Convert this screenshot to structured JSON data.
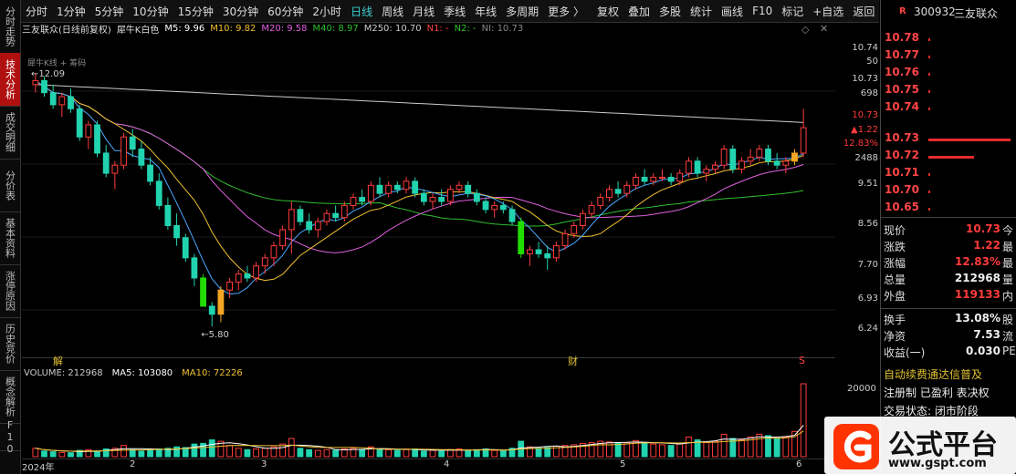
{
  "sidebar": {
    "tabs": [
      {
        "label": "分时走势",
        "active": false
      },
      {
        "label": "技术分析",
        "active": true
      },
      {
        "label": "成交明细",
        "active": false
      },
      {
        "label": "分价表",
        "active": false
      },
      {
        "label": "基本资料",
        "active": false
      },
      {
        "label": "涨停原因",
        "active": false
      },
      {
        "label": "历史竞价",
        "active": false
      },
      {
        "label": "概念解析",
        "active": false
      },
      {
        "label": "F10",
        "active": false
      }
    ]
  },
  "toolbar": {
    "periods": [
      "分时",
      "1分钟",
      "5分钟",
      "10分钟",
      "15分钟",
      "30分钟",
      "60分钟",
      "2小时",
      "日线",
      "周线",
      "月线",
      "季线",
      "年线",
      "多周期",
      "更多 〉"
    ],
    "active_period": "日线",
    "actions": [
      "复权",
      "叠加",
      "多股",
      "统计",
      "画线",
      "F10",
      "标记",
      "+自选",
      "返回"
    ]
  },
  "infoline": {
    "title": "三友联众(日线前复权)",
    "subtitle": "犀牛K白色",
    "ma5": "M5: 9.96",
    "ma10": "M10: 9.82",
    "ma20": "M20: 9.58",
    "ma40": "M40: 8.97",
    "ma250": "M250: 10.70",
    "n1": "N1: -",
    "n2": "N2: -",
    "ni": "NI: 10.73"
  },
  "chart_overlay": {
    "high_label": "12.09",
    "low_label": "←5.80",
    "small_label": "犀牛K线 + 筹码"
  },
  "markers": {
    "jie": "解",
    "cai": "财",
    "s": "S"
  },
  "price_axis": [
    "10.74",
    "50",
    "10.73",
    "698",
    "10.73",
    "▲1.22",
    "12.83%",
    "2488",
    "9.51",
    "8.56",
    "7.70",
    "6.93",
    "6.24"
  ],
  "volume": {
    "label": "VOLUME: 212968",
    "ma5": "MA5: 103080",
    "ma10": "MA10: 72226",
    "axis_top": "20000"
  },
  "time_axis": [
    "2024年",
    "2",
    "3",
    "4",
    "5",
    "6"
  ],
  "right_panel": {
    "code": "300932",
    "name": "三友联众",
    "badge": "R",
    "ladder": [
      {
        "price": "10.78",
        "bar": 2
      },
      {
        "price": "10.77",
        "bar": 2
      },
      {
        "price": "10.76",
        "bar": 2
      },
      {
        "price": "10.75",
        "bar": 2
      },
      {
        "price": "10.74",
        "bar": 2
      },
      {
        "price": "10.73",
        "bar": 100
      },
      {
        "price": "10.72",
        "bar": 55
      },
      {
        "price": "10.71",
        "bar": 2
      },
      {
        "price": "10.70",
        "bar": 2
      },
      {
        "price": "10.65",
        "bar": 2
      }
    ],
    "quote": [
      {
        "k": "现价",
        "v": "10.73",
        "k2": "今",
        "c": "red"
      },
      {
        "k": "涨跌",
        "v": "1.22",
        "k2": "最",
        "c": "red"
      },
      {
        "k": "涨幅",
        "v": "12.83%",
        "k2": "最",
        "c": "red"
      },
      {
        "k": "总量",
        "v": "212968",
        "k2": "量",
        "c": "white"
      },
      {
        "k": "外盘",
        "v": "119133",
        "k2": "内",
        "c": "red"
      }
    ],
    "quote2": [
      {
        "k": "换手",
        "v": "13.08%",
        "k2": "股",
        "c": "white"
      },
      {
        "k": "净资",
        "v": "7.53",
        "k2": "流",
        "c": "white"
      },
      {
        "k": "收益(一)",
        "v": "0.030",
        "k2": "PE",
        "c": "white"
      }
    ],
    "news": [
      {
        "text": "自动续费通达信普及",
        "c": "#e0c030"
      },
      {
        "text": "注册制 已盈利 表决权",
        "c": "#eee"
      },
      {
        "text": "交易状态: 闭市阶段",
        "c": "#eee"
      }
    ]
  },
  "watermark": {
    "brand": "公式平台",
    "url": "www.gspt.com"
  },
  "colors": {
    "up": "#ff3b3b",
    "down": "#22d3b0",
    "limit_up": "#f5a623",
    "limit_down": "#22dd00",
    "ma5": "#ffffff",
    "ma10": "#f0c030",
    "ma20": "#e060e0",
    "ma40": "#30c030",
    "ma250": "#cccccc"
  },
  "chart_data": {
    "type": "candlestick",
    "title": "三友联众(日线前复权)",
    "ylim": [
      5.8,
      12.09
    ],
    "candles": [
      [
        11.8,
        12.09,
        11.6,
        11.9
      ],
      [
        11.9,
        12.0,
        11.5,
        11.6
      ],
      [
        11.6,
        11.8,
        11.2,
        11.3
      ],
      [
        11.3,
        11.6,
        11.0,
        11.5
      ],
      [
        11.5,
        11.7,
        11.1,
        11.2
      ],
      [
        11.2,
        11.3,
        10.4,
        10.5
      ],
      [
        10.5,
        10.9,
        10.2,
        10.8
      ],
      [
        10.8,
        10.9,
        10.0,
        10.1
      ],
      [
        10.1,
        10.3,
        9.5,
        9.6
      ],
      [
        9.6,
        9.9,
        9.2,
        9.8
      ],
      [
        9.8,
        10.6,
        9.7,
        10.5
      ],
      [
        10.5,
        10.7,
        10.0,
        10.2
      ],
      [
        10.2,
        10.4,
        9.7,
        9.8
      ],
      [
        9.8,
        10.0,
        9.3,
        9.4
      ],
      [
        9.4,
        9.6,
        8.7,
        8.8
      ],
      [
        8.8,
        9.0,
        8.2,
        8.3
      ],
      [
        8.3,
        8.6,
        7.8,
        8.0
      ],
      [
        8.0,
        8.1,
        7.4,
        7.5
      ],
      [
        7.5,
        7.6,
        6.8,
        7.0
      ],
      [
        7.0,
        7.1,
        6.3,
        6.3
      ],
      [
        6.3,
        6.4,
        5.8,
        6.1
      ],
      [
        6.1,
        6.8,
        5.9,
        6.7
      ],
      [
        6.7,
        7.0,
        6.5,
        6.9
      ],
      [
        6.9,
        7.2,
        6.7,
        7.1
      ],
      [
        7.1,
        7.3,
        6.9,
        7.0
      ],
      [
        7.0,
        7.4,
        6.9,
        7.3
      ],
      [
        7.3,
        7.6,
        7.1,
        7.5
      ],
      [
        7.5,
        7.9,
        7.3,
        7.8
      ],
      [
        7.8,
        8.3,
        7.7,
        8.2
      ],
      [
        8.2,
        8.9,
        7.6,
        8.7
      ],
      [
        8.7,
        8.8,
        8.3,
        8.4
      ],
      [
        8.4,
        8.6,
        8.1,
        8.2
      ],
      [
        8.2,
        8.5,
        8.0,
        8.4
      ],
      [
        8.4,
        8.7,
        8.3,
        8.6
      ],
      [
        8.6,
        8.8,
        8.4,
        8.5
      ],
      [
        8.5,
        8.9,
        8.4,
        8.8
      ],
      [
        8.8,
        9.1,
        8.7,
        9.0
      ],
      [
        9.0,
        9.2,
        8.8,
        8.9
      ],
      [
        8.9,
        9.4,
        8.8,
        9.3
      ],
      [
        9.3,
        9.5,
        9.0,
        9.1
      ],
      [
        9.1,
        9.4,
        9.0,
        9.3
      ],
      [
        9.3,
        9.4,
        9.1,
        9.2
      ],
      [
        9.2,
        9.5,
        9.1,
        9.4
      ],
      [
        9.4,
        9.5,
        9.0,
        9.1
      ],
      [
        9.1,
        9.2,
        8.8,
        8.9
      ],
      [
        8.9,
        9.1,
        8.7,
        9.0
      ],
      [
        9.0,
        9.2,
        8.8,
        8.9
      ],
      [
        8.9,
        9.3,
        8.8,
        9.2
      ],
      [
        9.2,
        9.4,
        9.1,
        9.3
      ],
      [
        9.3,
        9.4,
        9.0,
        9.1
      ],
      [
        9.1,
        9.2,
        8.8,
        8.9
      ],
      [
        8.9,
        9.0,
        8.6,
        8.7
      ],
      [
        8.7,
        8.9,
        8.5,
        8.8
      ],
      [
        8.8,
        8.9,
        8.6,
        8.7
      ],
      [
        8.7,
        8.8,
        8.3,
        8.4
      ],
      [
        8.4,
        8.5,
        7.5,
        7.6
      ],
      [
        7.6,
        7.8,
        7.3,
        7.7
      ],
      [
        7.7,
        7.9,
        7.5,
        7.6
      ],
      [
        7.6,
        7.8,
        7.2,
        7.5
      ],
      [
        7.5,
        7.9,
        7.4,
        7.8
      ],
      [
        7.8,
        8.2,
        7.7,
        8.1
      ],
      [
        8.1,
        8.4,
        8.0,
        8.3
      ],
      [
        8.3,
        8.7,
        8.2,
        8.6
      ],
      [
        8.6,
        8.9,
        8.5,
        8.8
      ],
      [
        8.8,
        9.1,
        8.7,
        9.0
      ],
      [
        9.0,
        9.3,
        8.9,
        9.2
      ],
      [
        9.2,
        9.4,
        9.0,
        9.1
      ],
      [
        9.1,
        9.4,
        9.0,
        9.3
      ],
      [
        9.3,
        9.6,
        9.2,
        9.5
      ],
      [
        9.5,
        9.7,
        9.3,
        9.4
      ],
      [
        9.4,
        9.6,
        9.3,
        9.5
      ],
      [
        9.5,
        9.7,
        9.4,
        9.5
      ],
      [
        9.5,
        9.6,
        9.3,
        9.4
      ],
      [
        9.4,
        9.7,
        9.3,
        9.6
      ],
      [
        9.6,
        10.0,
        9.5,
        9.9
      ],
      [
        9.9,
        10.0,
        9.5,
        9.6
      ],
      [
        9.6,
        9.8,
        9.4,
        9.7
      ],
      [
        9.7,
        9.9,
        9.6,
        9.8
      ],
      [
        9.8,
        10.3,
        9.7,
        10.2
      ],
      [
        10.2,
        10.3,
        9.6,
        9.7
      ],
      [
        9.7,
        10.0,
        9.6,
        9.9
      ],
      [
        9.9,
        10.2,
        9.8,
        10.0
      ],
      [
        10.0,
        10.3,
        9.9,
        10.2
      ],
      [
        10.2,
        10.3,
        9.8,
        9.9
      ],
      [
        9.9,
        10.1,
        9.7,
        9.8
      ],
      [
        9.8,
        10.0,
        9.6,
        9.9
      ],
      [
        9.9,
        10.2,
        9.8,
        10.1
      ],
      [
        10.1,
        11.2,
        10.0,
        10.73
      ]
    ],
    "limit_candles": {
      "limit_up": [
        21,
        86
      ],
      "limit_down": [
        19,
        55
      ]
    },
    "volume": [
      60,
      40,
      35,
      30,
      28,
      45,
      50,
      40,
      55,
      60,
      80,
      50,
      40,
      45,
      55,
      60,
      70,
      65,
      90,
      95,
      120,
      110,
      80,
      60,
      50,
      55,
      60,
      70,
      90,
      130,
      60,
      50,
      45,
      50,
      45,
      55,
      60,
      50,
      70,
      55,
      50,
      45,
      50,
      55,
      40,
      45,
      40,
      50,
      55,
      45,
      50,
      55,
      45,
      40,
      60,
      110,
      70,
      60,
      65,
      75,
      80,
      85,
      95,
      100,
      110,
      105,
      95,
      100,
      115,
      100,
      90,
      85,
      80,
      95,
      140,
      120,
      100,
      110,
      160,
      130,
      120,
      140,
      160,
      150,
      130,
      140,
      180,
      520
    ]
  }
}
